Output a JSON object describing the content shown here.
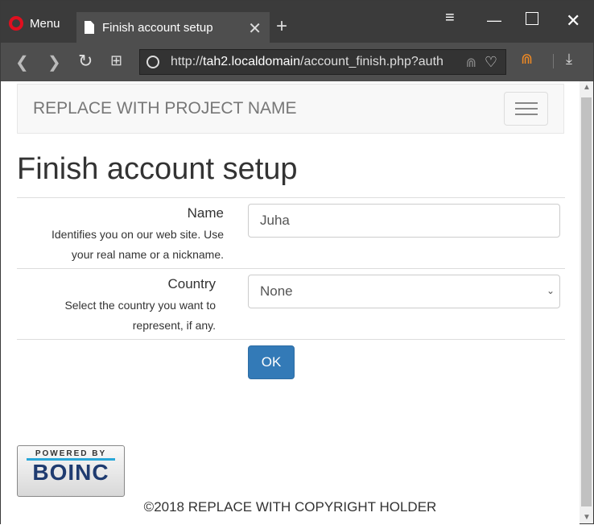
{
  "browser": {
    "menu_label": "Menu",
    "tab_title": "Finish account setup",
    "url_scheme": "http://",
    "url_host": "tah2.localdomain",
    "url_path": "/account_finish.php?auth"
  },
  "navbar": {
    "brand": "REPLACE WITH PROJECT NAME"
  },
  "page": {
    "title": "Finish account setup"
  },
  "form": {
    "name": {
      "label": "Name",
      "help_line1": "Identifies you on our web site. Use",
      "help_line2": "your real name or a nickname.",
      "value": "Juha"
    },
    "country": {
      "label": "Country",
      "help_line1": "Select the country you want to",
      "help_line2": "represent, if any.",
      "value": "None"
    },
    "submit_label": "OK"
  },
  "footer": {
    "badge_top": "POWERED BY",
    "badge_logo": "BOINC",
    "copyright": "©2018 REPLACE WITH COPYRIGHT HOLDER"
  }
}
